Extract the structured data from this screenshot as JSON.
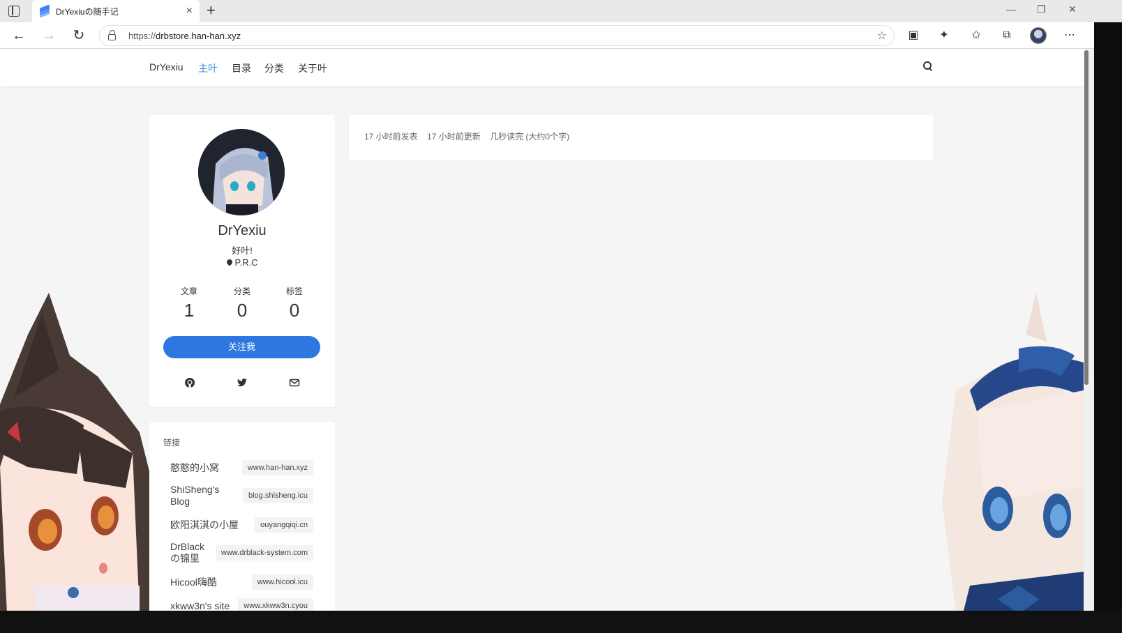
{
  "browser": {
    "tab_title": "DrYexiuの随手记",
    "tab_close": "×",
    "new_tab": "+",
    "url_proto": "https://",
    "url_host": "drbstore.han-han.xyz"
  },
  "nav": {
    "brand": "DrYexiu",
    "links": [
      "主叶",
      "目录",
      "分类",
      "关于叶"
    ],
    "active_index": 0
  },
  "profile": {
    "name": "DrYexiu",
    "motto": "好叶!",
    "location": "P.R.C",
    "stats": [
      {
        "label": "文章",
        "value": "1"
      },
      {
        "label": "分类",
        "value": "0"
      },
      {
        "label": "标签",
        "value": "0"
      }
    ],
    "follow_label": "关注我"
  },
  "links": {
    "title": "链接",
    "items": [
      {
        "name": "憨憨的小窝",
        "url": "www.han-han.xyz"
      },
      {
        "name": "ShiSheng's Blog",
        "url": "blog.shisheng.icu"
      },
      {
        "name": "欧阳淇淇の小屋",
        "url": "ouyangqiqi.cn"
      },
      {
        "name": "DrBlackの锦里",
        "url": "www.drblack-system.com"
      },
      {
        "name": "Hicool嗨酷",
        "url": "www.hicool.icu"
      },
      {
        "name": "xkww3n's site",
        "url": "www.xkww3n.cyou"
      }
    ]
  },
  "post": {
    "published": "17 小时前发表",
    "updated": "17 小时前更新",
    "read_time": "几秒读完 (大约0个字)"
  },
  "colors": {
    "accent": "#3a8dde",
    "button": "#2d77e0",
    "background": "#f5f5f5"
  }
}
